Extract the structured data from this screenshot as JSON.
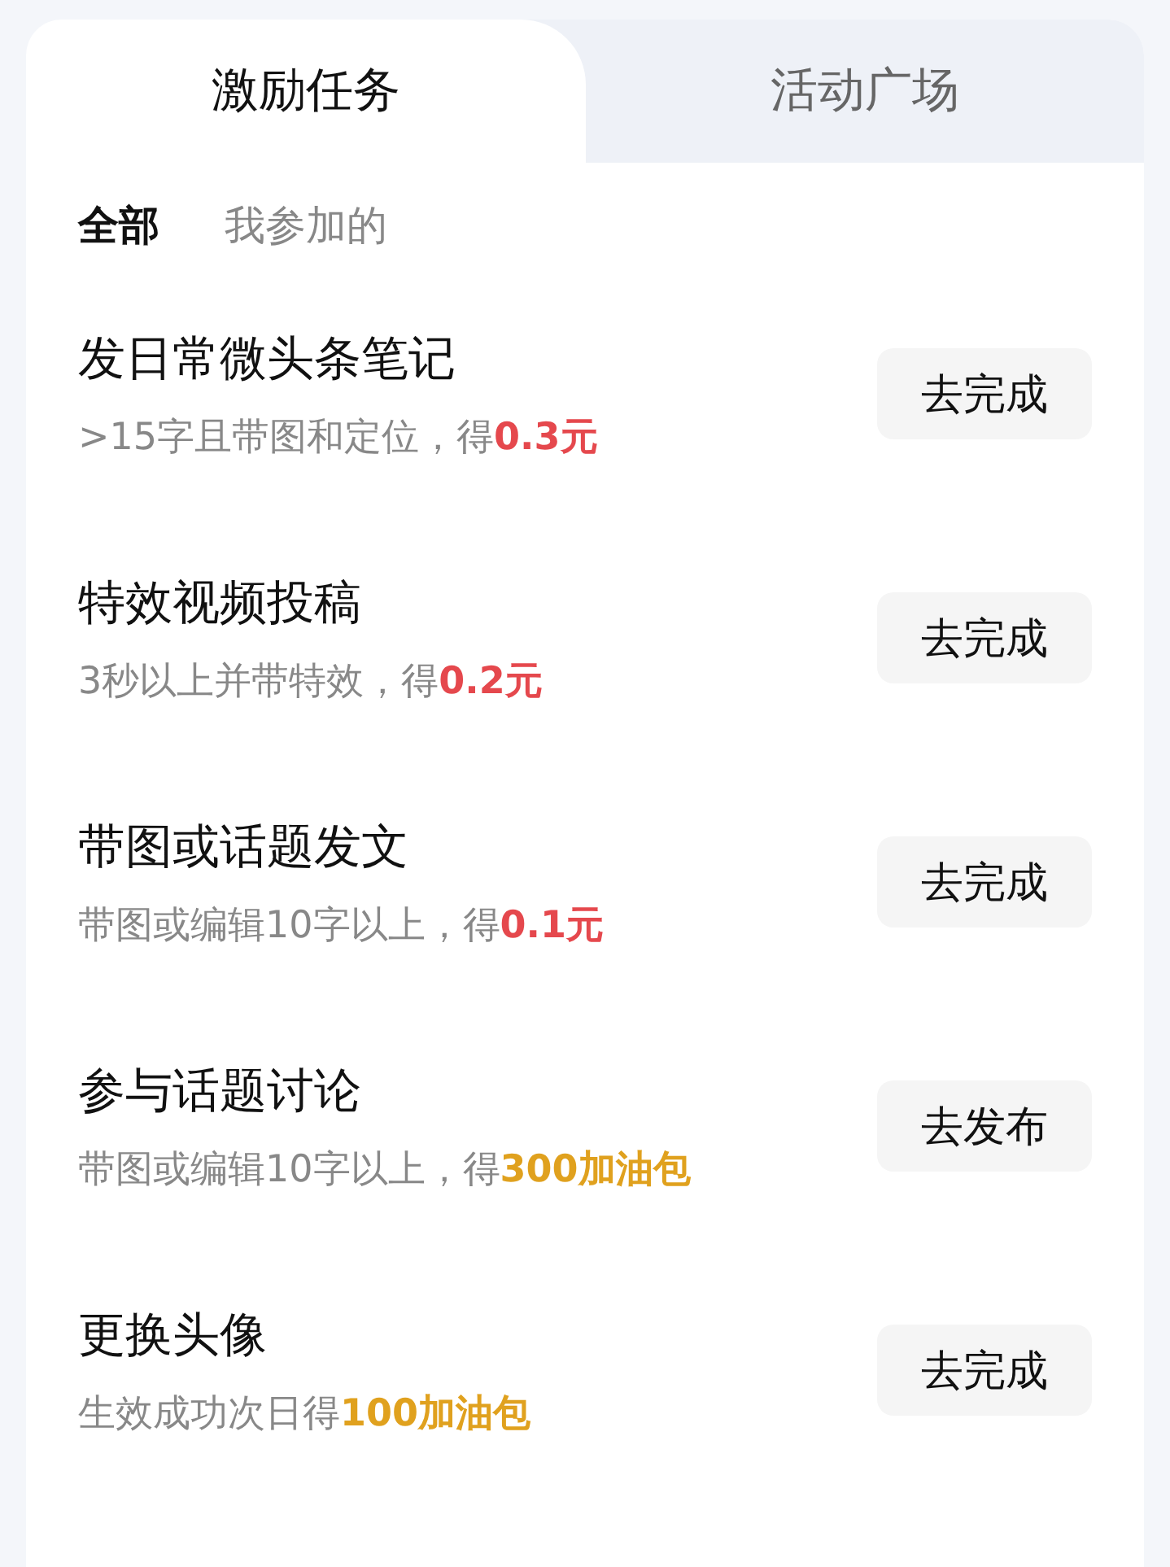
{
  "tabs": [
    {
      "label": "激励任务",
      "selected": true
    },
    {
      "label": "活动广场",
      "selected": false
    }
  ],
  "filters": [
    {
      "label": "全部",
      "selected": true
    },
    {
      "label": "我参加的",
      "selected": false
    }
  ],
  "tasks": [
    {
      "title": "发日常微头条笔记",
      "description": ">15字且带图和定位，得",
      "reward": "0.3元",
      "kind": "cash",
      "button": "去完成"
    },
    {
      "title": "特效视频投稿",
      "description": "3秒以上并带特效，得",
      "reward": "0.2元",
      "kind": "cash",
      "button": "去完成"
    },
    {
      "title": "带图或话题发文",
      "description": "带图或编辑10字以上，得",
      "reward": "0.1元",
      "kind": "cash",
      "button": "去完成"
    },
    {
      "title": "参与话题讨论",
      "description": "带图或编辑10字以上，得",
      "reward": "300加油包",
      "kind": "fuel",
      "button": "去发布"
    },
    {
      "title": "更换头像",
      "description": "生效成功次日得",
      "reward": "100加油包",
      "kind": "fuel",
      "button": "去完成"
    }
  ]
}
